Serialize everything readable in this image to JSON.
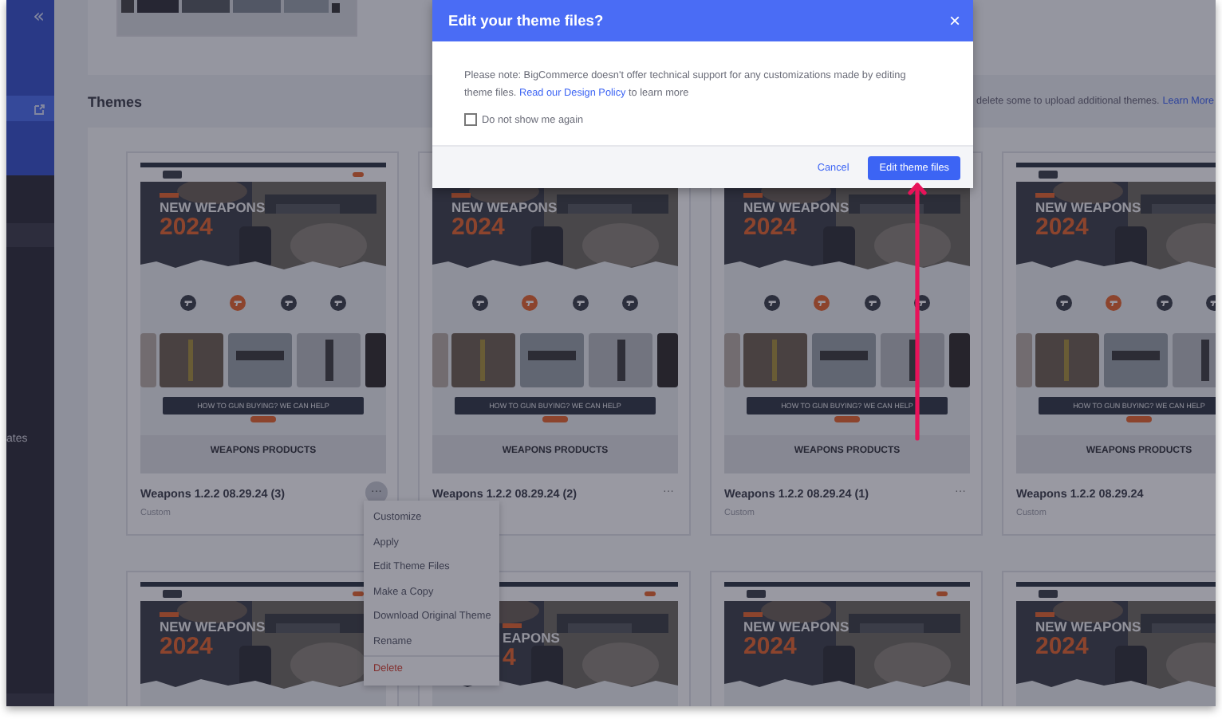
{
  "sidebar": {
    "collapse_button": "«",
    "items": [
      {
        "label": "ates"
      }
    ]
  },
  "notice": {
    "text": "delete some to upload additional themes.",
    "link": "Learn More"
  },
  "themes": {
    "heading": "Themes",
    "cards": [
      {
        "name": "Weapons 1.2.2 08.29.24 (3)",
        "type": "Custom",
        "actions": "···",
        "menu_open": true,
        "preview": {
          "hero_title": "NEW WEAPONS",
          "hero_year": "2024",
          "banner": "HOW TO GUN BUYING? WE CAN HELP",
          "section": "WEAPONS PRODUCTS"
        }
      },
      {
        "name": "Weapons 1.2.2 08.29.24 (2)",
        "actions": "···",
        "menu_open": false,
        "preview": {
          "hero_title": "NEW WEAPONS",
          "hero_year": "2024",
          "banner": "HOW TO GUN BUYING? WE CAN HELP",
          "section": "WEAPONS PRODUCTS"
        }
      },
      {
        "name": "Weapons 1.2.2 08.29.24 (1)",
        "type": "Custom",
        "actions": "···",
        "menu_open": false,
        "preview": {
          "hero_title": "NEW WEAPONS",
          "hero_year": "2024",
          "banner": "HOW TO GUN BUYING? WE CAN HELP",
          "section": "WEAPONS PRODUCTS"
        }
      },
      {
        "name": "Weapons 1.2.2 08.29.24",
        "type": "Custom",
        "preview": {
          "hero_title": "NEW WEAPONS",
          "hero_year": "2024",
          "banner": "HOW TO GUN BUYING? WE CAN HELP",
          "section": "WEAPONS PRODUCTS"
        }
      },
      {
        "preview": {
          "hero_title": "NEW WEAPONS",
          "hero_year": "2024"
        }
      },
      {
        "kind": "cut",
        "preview": {
          "hero_title": "EAPONS",
          "hero_year": "4"
        }
      },
      {
        "preview": {
          "hero_title": "NEW WEAPONS",
          "hero_year": "2024"
        }
      },
      {
        "preview": {
          "hero_title": "NEW WEAPONS",
          "hero_year": "2024"
        }
      }
    ]
  },
  "menu": {
    "items": [
      {
        "label": "Customize",
        "kind": "normal"
      },
      {
        "label": "Apply",
        "kind": "normal"
      },
      {
        "label": "Edit Theme Files",
        "kind": "normal"
      },
      {
        "label": "Make a Copy",
        "kind": "normal"
      },
      {
        "label": "Download Original Theme",
        "kind": "normal"
      },
      {
        "label": "Rename",
        "kind": "normal"
      },
      {
        "label": "Delete",
        "kind": "danger"
      }
    ]
  },
  "modal": {
    "title": "Edit your theme files?",
    "close": "×",
    "body_before": "Please note: BigCommerce doesn't offer technical support for any customizations made by editing theme files.",
    "link": "Read our Design Policy",
    "body_after": "to learn more",
    "checkbox": {
      "label": "Do not show me again",
      "checked": false
    },
    "buttons": [
      {
        "label": "Cancel",
        "kind": "link"
      },
      {
        "label": "Edit theme files",
        "kind": "primary"
      }
    ]
  },
  "annotations": [
    {
      "kind": "arrow"
    }
  ]
}
